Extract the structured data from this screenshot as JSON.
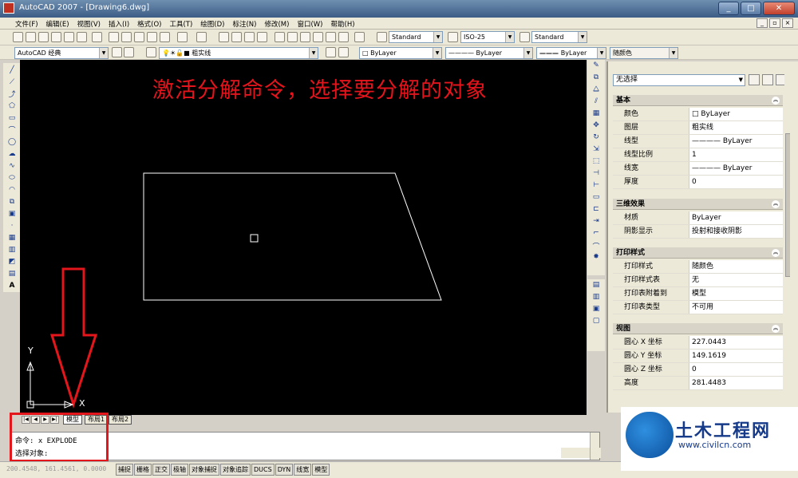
{
  "window": {
    "title": "AutoCAD 2007 - [Drawing6.dwg]",
    "buttons": [
      "_",
      "□",
      "✕"
    ]
  },
  "menu": [
    "文件(F)",
    "编辑(E)",
    "视图(V)",
    "插入(I)",
    "格式(O)",
    "工具(T)",
    "绘图(D)",
    "标注(N)",
    "修改(M)",
    "窗口(W)",
    "帮助(H)"
  ],
  "toolbar1": {
    "textstyle": "Standard",
    "dimstyle": "ISO-25",
    "tablestyle": "Standard"
  },
  "toolbar2": {
    "workspace": "AutoCAD 经典",
    "layer": "粗实线",
    "color": "ByLayer",
    "linetype": "ByLayer",
    "lineweight": "ByLayer",
    "plotstyle": "随颜色"
  },
  "annotation": "激活分解命令，选择要分解的对象",
  "ucs": {
    "x": "X",
    "y": "Y"
  },
  "layout_tabs": [
    "模型",
    "布局1",
    "布局2"
  ],
  "command": {
    "line1": "命令: x EXPLODE",
    "line2": "选择对象:"
  },
  "status": {
    "coords": "200.4548, 161.4561, 0.0000",
    "buttons": [
      "捕捉",
      "栅格",
      "正交",
      "极轴",
      "对象捕捉",
      "对象追踪",
      "DUCS",
      "DYN",
      "线宽",
      "模型"
    ]
  },
  "properties": {
    "selection": "无选择",
    "sections": [
      {
        "title": "基本",
        "rows": [
          [
            "颜色",
            "ByLayer"
          ],
          [
            "图层",
            "粗实线"
          ],
          [
            "线型",
            "———— ByLayer"
          ],
          [
            "线型比例",
            "1"
          ],
          [
            "线宽",
            "———— ByLayer"
          ],
          [
            "厚度",
            "0"
          ]
        ]
      },
      {
        "title": "三维效果",
        "rows": [
          [
            "材质",
            "ByLayer"
          ],
          [
            "阴影显示",
            "投射和接收阴影"
          ]
        ]
      },
      {
        "title": "打印样式",
        "rows": [
          [
            "打印样式",
            "随颜色"
          ],
          [
            "打印样式表",
            "无"
          ],
          [
            "打印表附着到",
            "模型"
          ],
          [
            "打印表类型",
            "不可用"
          ]
        ]
      },
      {
        "title": "视图",
        "rows": [
          [
            "圆心 X 坐标",
            "227.0443"
          ],
          [
            "圆心 Y 坐标",
            "149.1619"
          ],
          [
            "圆心 Z 坐标",
            "0"
          ],
          [
            "高度",
            "281.4483"
          ]
        ]
      }
    ]
  },
  "watermark": {
    "name": "土木工程网",
    "url": "www.civilcn.com"
  }
}
